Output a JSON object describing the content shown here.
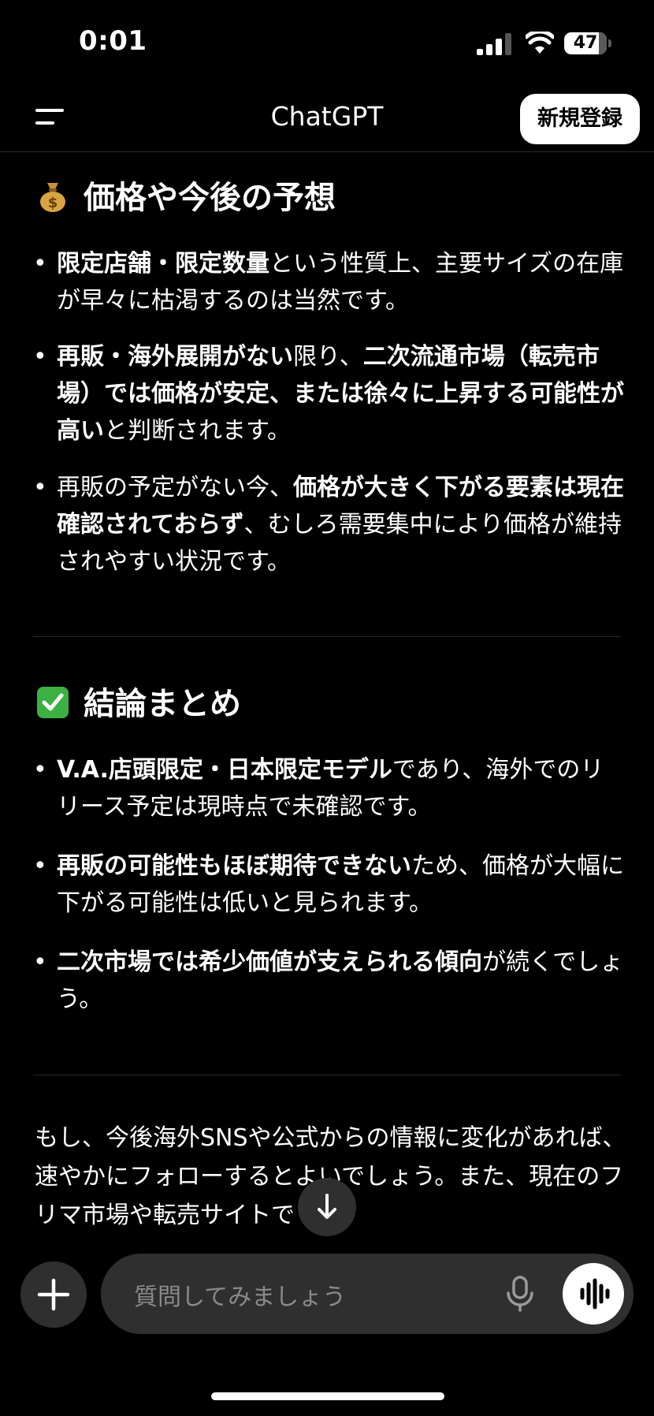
{
  "status": {
    "time": "0:01",
    "battery": "47"
  },
  "header": {
    "title": "ChatGPT",
    "signup_label": "新規登録"
  },
  "section1": {
    "heading": "価格や今後の予想",
    "bullets": [
      {
        "bold": "限定店舗・限定数量",
        "rest": "という性質上、主要サイズの在庫が早々に枯渇するのは当然です。"
      },
      {
        "bold1": "再販・海外展開がない",
        "mid": "限り、",
        "bold2": "二次流通市場（転売市場）では価格が安定、または徐々に上昇する可能性が高い",
        "rest": "と判断されます。"
      },
      {
        "pre": "再販の予定がない今、",
        "bold": "価格が大きく下がる要素は現在確認されておらず",
        "rest": "、むしろ需要集中により価格が維持されやすい状況です。"
      }
    ]
  },
  "section2": {
    "heading": "結論まとめ",
    "bullets": [
      {
        "bold": "V.A.店頭限定・日本限定モデル",
        "rest": "であり、海外でのリリース予定は現時点で未確認です。"
      },
      {
        "bold": "再販の可能性もほぼ期待できない",
        "rest": "ため、価格が大幅に下がる可能性は低いと見られます。"
      },
      {
        "bold": "二次市場では希少価値が支えられる傾向",
        "rest": "が続くでしょう。"
      }
    ]
  },
  "closing": {
    "text": "もし、今後海外SNSや公式からの情報に変化があれば、速やかにフォローするとよいでしょう。また、現在のフリマ市場や転売サイトで"
  },
  "input": {
    "placeholder": "質問してみましょう"
  }
}
